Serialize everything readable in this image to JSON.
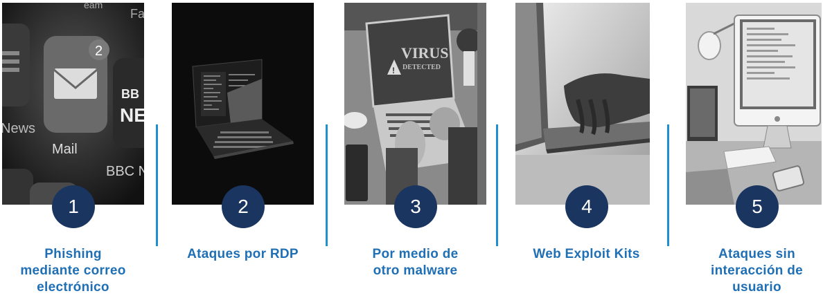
{
  "steps": [
    {
      "number": "1",
      "label_lines": [
        "Phishing",
        "mediante correo",
        "electrónico"
      ],
      "photo_icon": "mail-app-photo-icon",
      "photo_text": {
        "badge": "2",
        "app1": "Mail",
        "app2": "BBC Ne",
        "app3": "News",
        "app4": "BB",
        "app5": "NEW",
        "top1": "Fa",
        "top2": "eam"
      }
    },
    {
      "number": "2",
      "label_lines": [
        "Ataques por RDP"
      ],
      "photo_icon": "laptop-dark-photo-icon"
    },
    {
      "number": "3",
      "label_lines": [
        "Por medio de",
        "otro malware"
      ],
      "photo_icon": "virus-laptop-photo-icon",
      "photo_text": {
        "screen_line1": "VIRUS",
        "screen_line2": "DETECTED"
      }
    },
    {
      "number": "4",
      "label_lines": [
        "Web Exploit Kits"
      ],
      "photo_icon": "typing-laptop-photo-icon"
    },
    {
      "number": "5",
      "label_lines": [
        "Ataques sin",
        "interacción de",
        "usuario"
      ],
      "photo_icon": "desk-computer-photo-icon"
    }
  ],
  "colors": {
    "circle": "#1a3560",
    "label": "#1f6fb5",
    "divider": "#1f8fd0"
  }
}
